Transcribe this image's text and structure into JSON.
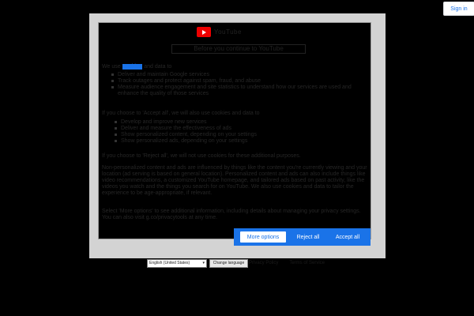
{
  "header": {
    "sign_in": "Sign in"
  },
  "dialog": {
    "logo_text": "YouTube",
    "title": "Before you continue to YouTube",
    "intro": [
      "We use",
      "cookies",
      "and data to"
    ],
    "bullets_a": [
      "Deliver and maintain Google services",
      "Track outages and protect against spam, fraud, and abuse",
      "Measure audience engagement and site statistics to understand how our services are used and enhance the quality of those services"
    ],
    "section_b": "If you choose to 'Accept all', we will also use cookies and data to",
    "bullets_b": [
      "Develop and improve new services",
      "Deliver and measure the effectiveness of ads",
      "Show personalized content, depending on your settings",
      "Show personalized ads, depending on your settings"
    ],
    "section_c": "If you choose to 'Reject all', we will not use cookies for these additional purposes.",
    "para_d": "Non-personalized content and ads are influenced by things like the content you're currently viewing and your location (ad serving is based on general location). Personalized content and ads can also include things like video recommendations, a customized YouTube homepage, and tailored ads based on past activity, like the videos you watch and the things you search for on YouTube. We also use cookies and data to tailor the experience to be age-appropriate, if relevant.",
    "para_e": "Select 'More options' to see additional information, including details about managing your privacy settings. You can also visit g.co/privacytools at any time.",
    "buttons": {
      "more": "More options",
      "reject": "Reject all",
      "accept": "Accept all"
    }
  },
  "footer": {
    "language_value": "English (United States)",
    "change_language": "Change language",
    "links": [
      "Privacy Policy",
      "Terms of Service"
    ]
  },
  "colors": {
    "accent": "#1a73e8",
    "dialog_frame": "#d3d3d3",
    "background": "#000000"
  }
}
